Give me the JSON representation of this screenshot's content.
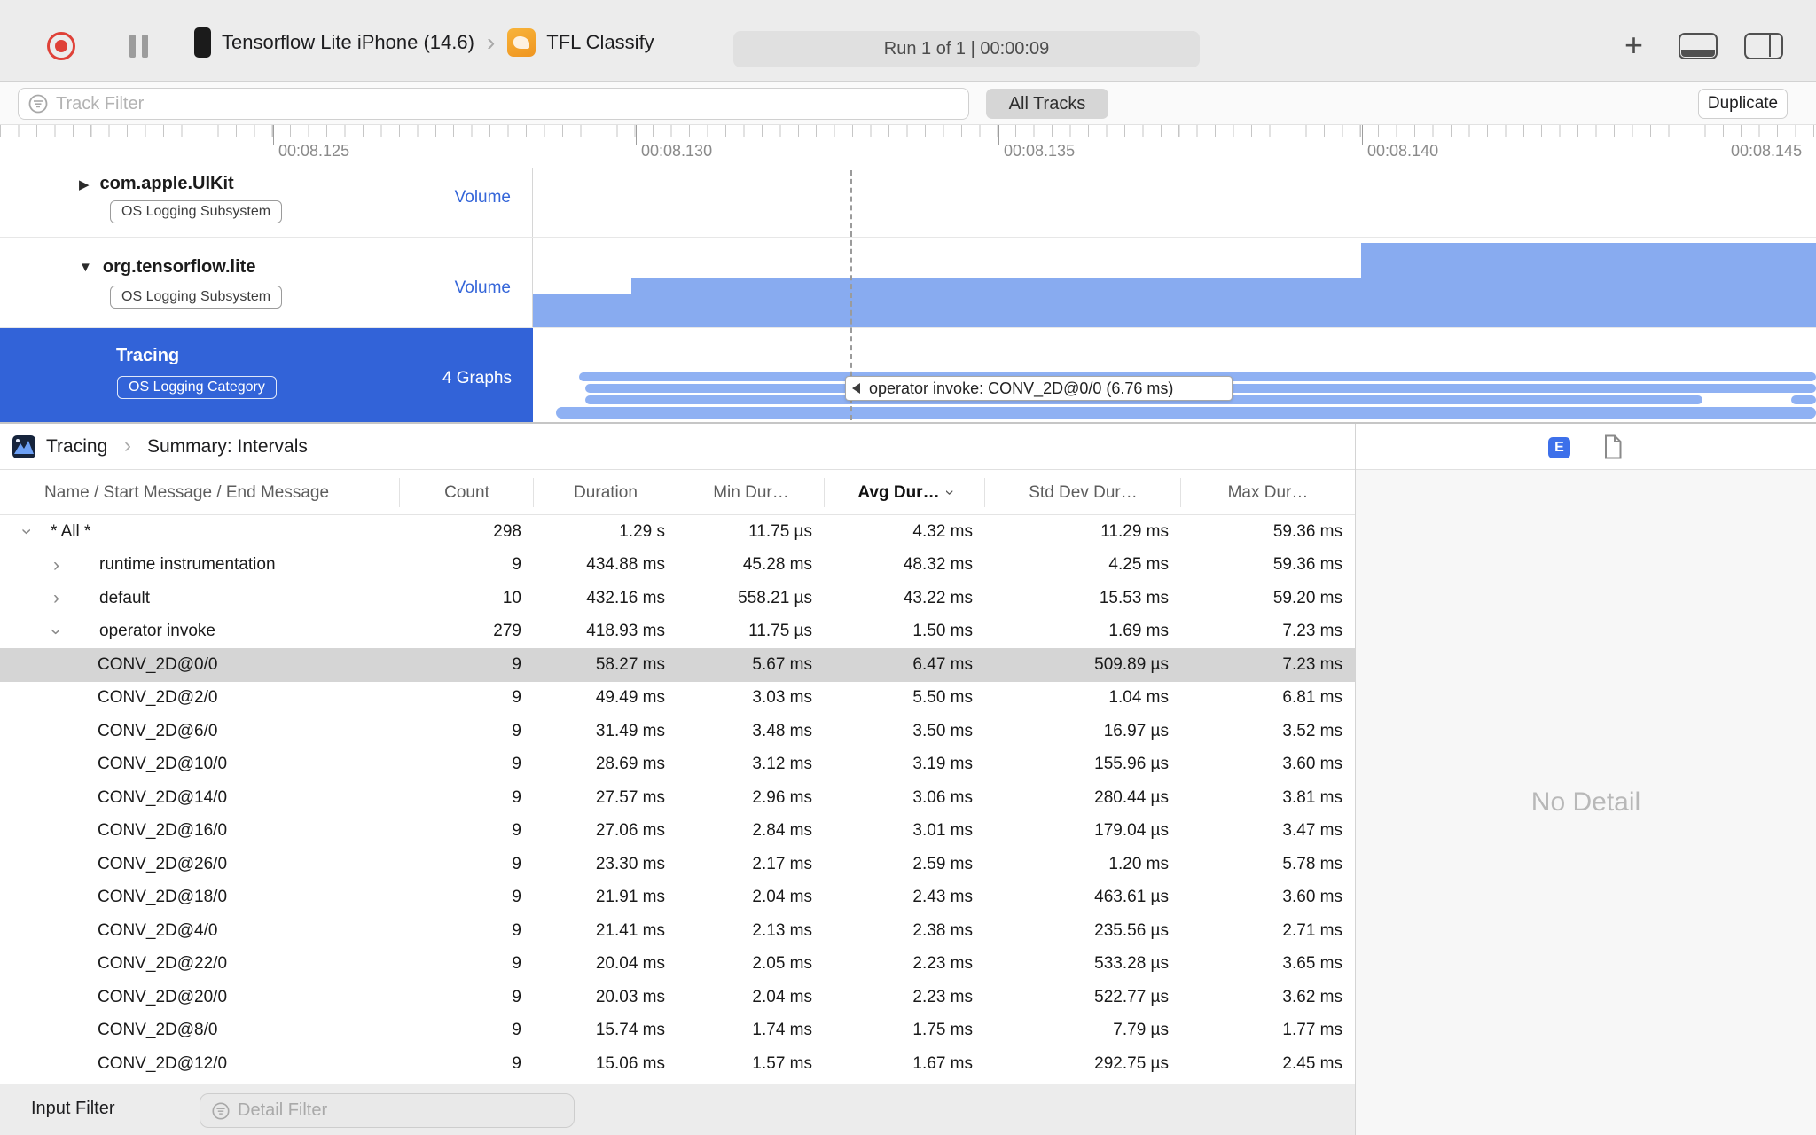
{
  "icons": {
    "chevron": "›",
    "plus": "+",
    "triangle_right": "▶",
    "triangle_down": "▼"
  },
  "colors": {
    "accent_blue": "#3263d8",
    "track_area_blue": "#88abf0",
    "interval_capsule_blue": "#8fb1f3",
    "volume_label_blue": "#3566d9",
    "record_red": "#df4138",
    "extended_detail_blue": "#3d70ea",
    "selected_row_gray": "#d5d5d5"
  },
  "toolbar": {
    "device_name": "Tensorflow Lite iPhone (14.6)",
    "app_name": "TFL Classify",
    "run_status": "Run 1 of 1  |  00:00:09"
  },
  "filter_bar": {
    "track_filter_placeholder": "Track Filter",
    "all_tracks": "All Tracks",
    "duplicate": "Duplicate"
  },
  "ruler": {
    "labels": [
      "00:08.125",
      "00:08.130",
      "00:08.135",
      "00:08.140",
      "00:08.145"
    ]
  },
  "tracks": [
    {
      "name": "com.apple.UIKit",
      "badge": "OS Logging Subsystem",
      "meta": "Volume",
      "disclosure": "collapsed"
    },
    {
      "name": "org.tensorflow.lite",
      "badge": "OS Logging Subsystem",
      "meta": "Volume",
      "disclosure": "expanded"
    },
    {
      "name": "Tracing",
      "badge": "OS Logging Category",
      "meta": "4 Graphs",
      "selected": true
    }
  ],
  "timeline": {
    "tooltip": "operator invoke: CONV_2D@0/0 (6.76 ms)"
  },
  "detail_header": {
    "breadcrumb": [
      "Tracing",
      "Summary: Intervals"
    ],
    "extended_detail_button": "E"
  },
  "table": {
    "columns": [
      "Name / Start Message / End Message",
      "Count",
      "Duration",
      "Min Dur…",
      "Avg Dur…",
      "Std Dev Dur…",
      "Max Dur…"
    ],
    "sorted_column": "Avg Dur…",
    "rows": [
      {
        "name": "* All *",
        "level": 0,
        "disclosure": "expanded",
        "count": "298",
        "duration": "1.29 s",
        "min": "11.75 µs",
        "avg": "4.32 ms",
        "stddev": "11.29 ms",
        "max": "59.36 ms"
      },
      {
        "name": "runtime instrumentation",
        "level": 1,
        "disclosure": "collapsed",
        "count": "9",
        "duration": "434.88 ms",
        "min": "45.28 ms",
        "avg": "48.32 ms",
        "stddev": "4.25 ms",
        "max": "59.36 ms"
      },
      {
        "name": "default",
        "level": 1,
        "disclosure": "collapsed",
        "count": "10",
        "duration": "432.16 ms",
        "min": "558.21 µs",
        "avg": "43.22 ms",
        "stddev": "15.53 ms",
        "max": "59.20 ms"
      },
      {
        "name": "operator invoke",
        "level": 1,
        "disclosure": "expanded",
        "count": "279",
        "duration": "418.93 ms",
        "min": "11.75 µs",
        "avg": "1.50 ms",
        "stddev": "1.69 ms",
        "max": "7.23 ms"
      },
      {
        "name": "CONV_2D@0/0",
        "level": 2,
        "selected": true,
        "count": "9",
        "duration": "58.27 ms",
        "min": "5.67 ms",
        "avg": "6.47 ms",
        "stddev": "509.89 µs",
        "max": "7.23 ms"
      },
      {
        "name": "CONV_2D@2/0",
        "level": 2,
        "count": "9",
        "duration": "49.49 ms",
        "min": "3.03 ms",
        "avg": "5.50 ms",
        "stddev": "1.04 ms",
        "max": "6.81 ms"
      },
      {
        "name": "CONV_2D@6/0",
        "level": 2,
        "count": "9",
        "duration": "31.49 ms",
        "min": "3.48 ms",
        "avg": "3.50 ms",
        "stddev": "16.97 µs",
        "max": "3.52 ms"
      },
      {
        "name": "CONV_2D@10/0",
        "level": 2,
        "count": "9",
        "duration": "28.69 ms",
        "min": "3.12 ms",
        "avg": "3.19 ms",
        "stddev": "155.96 µs",
        "max": "3.60 ms"
      },
      {
        "name": "CONV_2D@14/0",
        "level": 2,
        "count": "9",
        "duration": "27.57 ms",
        "min": "2.96 ms",
        "avg": "3.06 ms",
        "stddev": "280.44 µs",
        "max": "3.81 ms"
      },
      {
        "name": "CONV_2D@16/0",
        "level": 2,
        "count": "9",
        "duration": "27.06 ms",
        "min": "2.84 ms",
        "avg": "3.01 ms",
        "stddev": "179.04 µs",
        "max": "3.47 ms"
      },
      {
        "name": "CONV_2D@26/0",
        "level": 2,
        "count": "9",
        "duration": "23.30 ms",
        "min": "2.17 ms",
        "avg": "2.59 ms",
        "stddev": "1.20 ms",
        "max": "5.78 ms"
      },
      {
        "name": "CONV_2D@18/0",
        "level": 2,
        "count": "9",
        "duration": "21.91 ms",
        "min": "2.04 ms",
        "avg": "2.43 ms",
        "stddev": "463.61 µs",
        "max": "3.60 ms"
      },
      {
        "name": "CONV_2D@4/0",
        "level": 2,
        "count": "9",
        "duration": "21.41 ms",
        "min": "2.13 ms",
        "avg": "2.38 ms",
        "stddev": "235.56 µs",
        "max": "2.71 ms"
      },
      {
        "name": "CONV_2D@22/0",
        "level": 2,
        "count": "9",
        "duration": "20.04 ms",
        "min": "2.05 ms",
        "avg": "2.23 ms",
        "stddev": "533.28 µs",
        "max": "3.65 ms"
      },
      {
        "name": "CONV_2D@20/0",
        "level": 2,
        "count": "9",
        "duration": "20.03 ms",
        "min": "2.04 ms",
        "avg": "2.23 ms",
        "stddev": "522.77 µs",
        "max": "3.62 ms"
      },
      {
        "name": "CONV_2D@8/0",
        "level": 2,
        "count": "9",
        "duration": "15.74 ms",
        "min": "1.74 ms",
        "avg": "1.75 ms",
        "stddev": "7.79 µs",
        "max": "1.77 ms"
      },
      {
        "name": "CONV_2D@12/0",
        "level": 2,
        "count": "9",
        "duration": "15.06 ms",
        "min": "1.57 ms",
        "avg": "1.67 ms",
        "stddev": "292.75 µs",
        "max": "2.45 ms"
      }
    ]
  },
  "right_panel": {
    "empty_message": "No Detail"
  },
  "bottom_bar": {
    "input_filter_label": "Input Filter",
    "detail_filter_placeholder": "Detail Filter"
  }
}
